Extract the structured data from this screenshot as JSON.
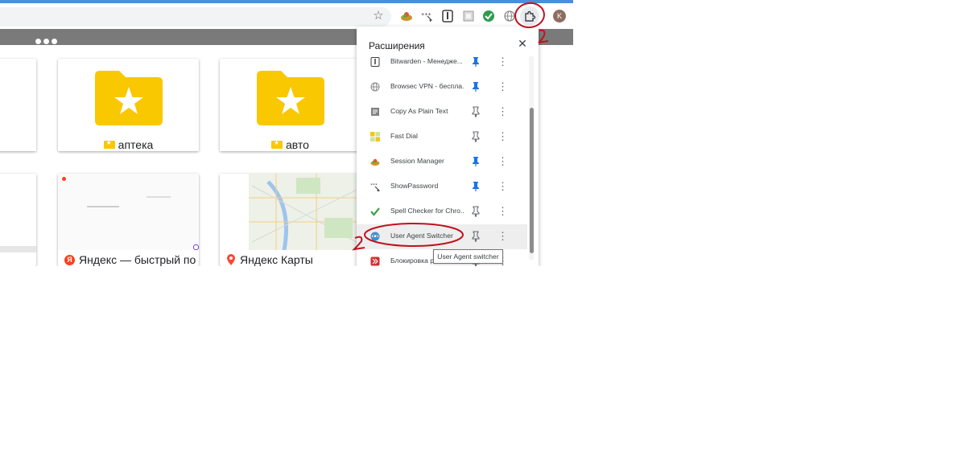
{
  "toolbar": {
    "avatar_letter": "K",
    "extension_icons": [
      "session-manager",
      "show-password",
      "bitwarden",
      "copy-as-plain-text",
      "spell-checker",
      "browsec-vpn"
    ]
  },
  "tiles": {
    "folders": [
      {
        "label": "аптека"
      },
      {
        "label": "авто"
      }
    ],
    "sites": [
      {
        "label": "Яндекс — быстрый по"
      },
      {
        "label": "Яндекс Карты"
      }
    ]
  },
  "popup": {
    "title": "Расширения",
    "close_glyph": "✕",
    "items": [
      {
        "name": "Bitwarden - Менедже...",
        "pinned": true
      },
      {
        "name": "Browsec VPN - беспла...",
        "pinned": true
      },
      {
        "name": "Copy As Plain Text",
        "pinned": false
      },
      {
        "name": "Fast Dial",
        "pinned": false
      },
      {
        "name": "Session Manager",
        "pinned": true
      },
      {
        "name": "ShowPassword",
        "pinned": true
      },
      {
        "name": "Spell Checker for Chro...",
        "pinned": false
      },
      {
        "name": "User Agent Switcher",
        "pinned": false
      },
      {
        "name": "Блокировка р",
        "pinned": false
      }
    ],
    "tooltip": "User Agent switcher"
  },
  "colors": {
    "accent": "#4a8fd8",
    "folder_yellow": "#f9c800",
    "pin_blue": "#1a73e8",
    "annotation_red": "#c0121f"
  }
}
